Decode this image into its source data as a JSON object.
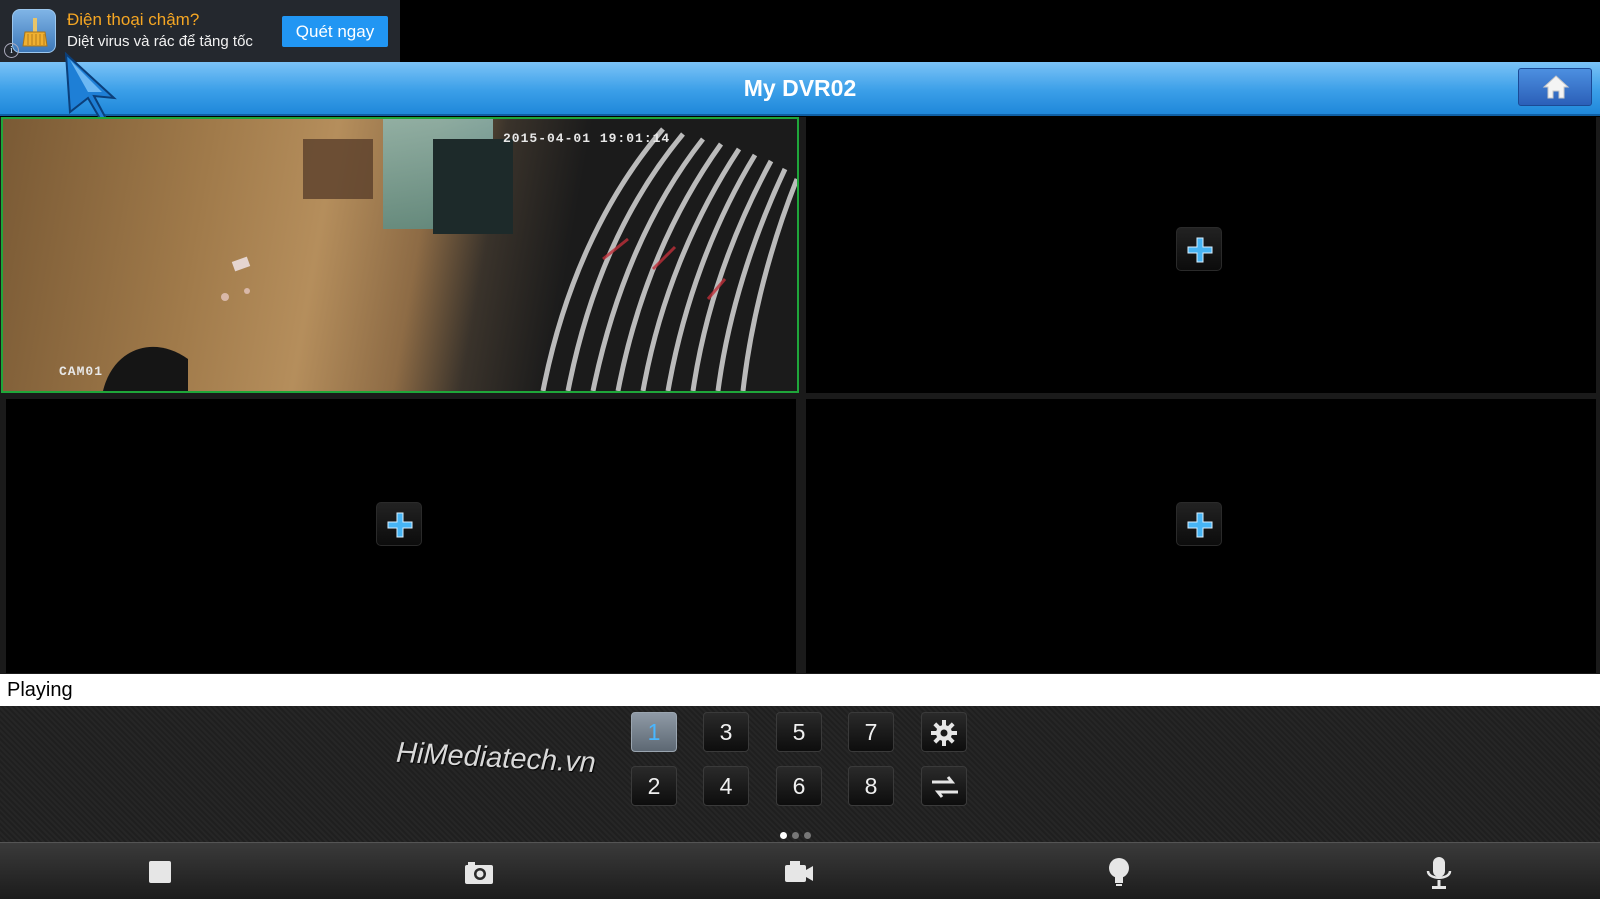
{
  "ad": {
    "title": "Điện thoại chậm?",
    "subtitle": "Diệt virus và rác để tăng tốc",
    "cta_label": "Quét ngay",
    "info_glyph": "i",
    "icon": "broom-cleaner-icon"
  },
  "header": {
    "title": "My DVR02",
    "home_icon": "home-icon",
    "color": "#2f95e4"
  },
  "video_grid": {
    "cells": [
      {
        "name": "CAM01 feed",
        "timestamp": "2015-04-01 19:01:14",
        "camera_label": "CAM01",
        "state": "playing"
      },
      {
        "state": "empty",
        "action_icon": "plus-icon"
      },
      {
        "state": "empty",
        "action_icon": "plus-icon"
      },
      {
        "state": "empty",
        "action_icon": "plus-icon"
      }
    ],
    "selected_border_color": "#1fa63a",
    "plus_color": "#47b5f5"
  },
  "status": {
    "text": "Playing"
  },
  "panel": {
    "brand": "HiMediatech.vn",
    "channels_top": [
      "1",
      "3",
      "5",
      "7"
    ],
    "channels_bottom": [
      "2",
      "4",
      "6",
      "8"
    ],
    "active_channel": "1",
    "settings_icon": "gear-icon",
    "switch_icon": "swap-arrows-icon",
    "page_indicator": {
      "pages": 3,
      "current": 1
    }
  },
  "toolbar": {
    "items": [
      "stop-icon",
      "snapshot-camera-icon",
      "record-video-icon",
      "light-bulb-icon",
      "microphone-icon"
    ]
  }
}
